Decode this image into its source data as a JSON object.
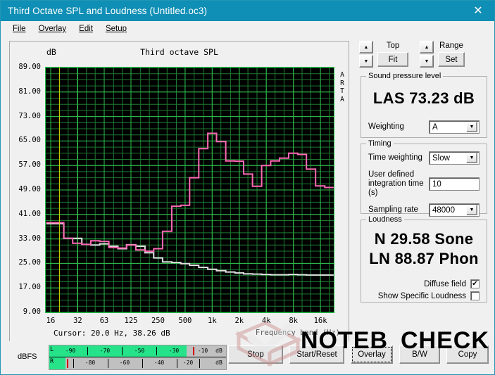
{
  "window": {
    "title": "Third Octave SPL and Loudness (Untitled.oc3)",
    "close_icon": "close-icon",
    "titlebar_color": "#0f8fb5"
  },
  "menu": [
    {
      "label": "File"
    },
    {
      "label": "Overlay"
    },
    {
      "label": "Edit"
    },
    {
      "label": "Setup"
    }
  ],
  "chart_panel": {
    "title": "Third octave SPL",
    "y_unit": "dB",
    "watermark_label": "ARTA",
    "cursor": "Cursor:   20.0 Hz, 38.26 dB",
    "x_axis_title": "Frequency band (Hz)"
  },
  "controls": {
    "top_label": "Top",
    "fit_label": "Fit",
    "range_label": "Range",
    "set_label": "Set",
    "up_arrow": "▲",
    "down_arrow": "▼"
  },
  "sound_pressure_level": {
    "legend": "Sound pressure level",
    "value": "LAS 73.23 dB",
    "weighting_label": "Weighting",
    "weighting_value": "A"
  },
  "timing": {
    "legend": "Timing",
    "time_weighting_label": "Time weighting",
    "time_weighting_value": "Slow",
    "integration_label": "User defined integration time (s)",
    "integration_value": "10",
    "sampling_label": "Sampling rate",
    "sampling_value": "48000"
  },
  "loudness": {
    "legend": "Loudness",
    "sone": "N 29.58 Sone",
    "phon": "LN 88.87 Phon",
    "diffuse_field_label": "Diffuse field",
    "diffuse_field_checked": "✔",
    "specific_loudness_label": "Show Specific Loudness",
    "specific_loudness_checked": ""
  },
  "bottom_bar": {
    "dbfs_label": "dBFS",
    "left_channel": "L",
    "right_channel": "R",
    "unit": "dB",
    "left_ticks": [
      "-90",
      "-70",
      "-50",
      "-30",
      "-10"
    ],
    "right_ticks": [
      "-80",
      "-60",
      "-40",
      "-20"
    ],
    "buttons": [
      {
        "label": "Stop",
        "focused": false
      },
      {
        "label": "Start/Reset",
        "focused": false
      },
      {
        "label": "Overlay",
        "focused": true
      },
      {
        "label": "B/W",
        "focused": false
      },
      {
        "label": "Copy",
        "focused": false
      }
    ]
  },
  "watermark": {
    "text_a": "NOTEBOOK",
    "text_b": "CHECK"
  },
  "chart_data": {
    "type": "line",
    "title": "Third octave SPL",
    "xlabel": "Frequency band (Hz)",
    "ylabel": "dB",
    "ylim": [
      9,
      89
    ],
    "ytick_labels": [
      "89.00",
      "81.00",
      "73.00",
      "65.00",
      "57.00",
      "49.00",
      "41.00",
      "33.00",
      "25.00",
      "17.00",
      "9.00"
    ],
    "yticks": [
      89,
      81,
      73,
      65,
      57,
      49,
      41,
      33,
      25,
      17,
      9
    ],
    "xtick_labels": [
      "16",
      "32",
      "63",
      "125",
      "250",
      "500",
      "1k",
      "2k",
      "4k",
      "8k",
      "16k"
    ],
    "xticks": [
      16,
      32,
      63,
      125,
      250,
      500,
      1000,
      2000,
      4000,
      8000,
      16000
    ],
    "grid": true,
    "background": "#000000",
    "grid_color": "#1e7a32",
    "grid_color_major": "#2fbf4e",
    "cursor_line": {
      "x_hz": 20.0,
      "y_db": 38.26,
      "color": "#d4d400"
    },
    "series": [
      {
        "name": "Third octave SPL",
        "color": "#ff69b4",
        "style": "step",
        "bands_hz": [
          16,
          20,
          25,
          31.5,
          40,
          50,
          63,
          80,
          100,
          125,
          160,
          200,
          250,
          315,
          400,
          500,
          630,
          800,
          1000,
          1250,
          1600,
          2000,
          2500,
          3150,
          4000,
          5000,
          6300,
          8000,
          10000,
          12500,
          16000,
          20000
        ],
        "values_db": [
          38.3,
          38.3,
          33.2,
          31.6,
          31.2,
          32.4,
          32.2,
          30.2,
          30.0,
          31.0,
          29.4,
          29.0,
          29.8,
          35.5,
          43.7,
          44.0,
          53.0,
          62.5,
          67.5,
          64.8,
          58.5,
          58.4,
          54.2,
          50.2,
          57.0,
          58.5,
          59.4,
          61.0,
          60.6,
          55.8,
          50.3,
          49.8
        ]
      },
      {
        "name": "Overlay",
        "color": "#e0e0e0",
        "style": "step",
        "bands_hz": [
          16,
          20,
          25,
          31.5,
          40,
          50,
          63,
          80,
          100,
          125,
          160,
          200,
          250,
          315,
          400,
          500,
          630,
          800,
          1000,
          1250,
          1600,
          2000,
          2500,
          3150,
          4000,
          5000,
          6300,
          8000,
          10000,
          12500,
          16000,
          20000
        ],
        "values_db": [
          38.0,
          38.0,
          33.2,
          33.2,
          31.2,
          31.0,
          31.4,
          30.6,
          29.8,
          31.1,
          30.6,
          28.5,
          26.8,
          25.5,
          25.3,
          24.9,
          24.4,
          23.7,
          23.1,
          22.6,
          22.2,
          21.9,
          21.6,
          21.5,
          21.4,
          21.3,
          21.3,
          21.4,
          21.3,
          21.2,
          21.2,
          21.2
        ]
      }
    ]
  }
}
